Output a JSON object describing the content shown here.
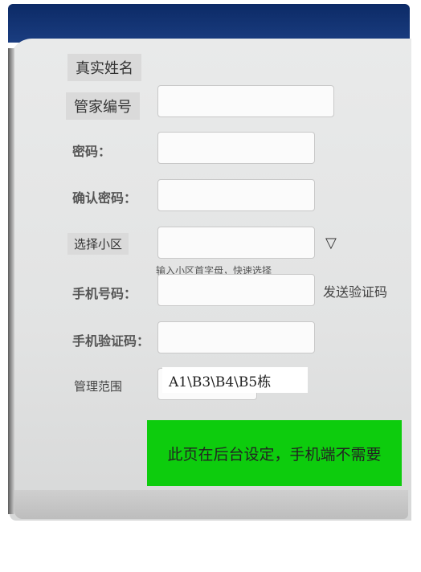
{
  "form": {
    "real_name_label": "真实姓名",
    "butler_id_label": "管家编号",
    "password_label": "密码：",
    "confirm_password_label": "确认密码：",
    "community_label": "选择小区",
    "community_hint": "输入小区首字母，快速选择",
    "phone_label": "手机号码：",
    "send_code_label": "发送验证码",
    "code_label": "手机验证码：",
    "range_label": "管理范围",
    "range_value": "A1\\B3\\B4\\B5栋"
  },
  "note": {
    "text": "此页在后台设定，手机端不需要",
    "bg_color": "#0dcc0d"
  },
  "icons": {
    "dropdown": "triangle-down-icon"
  }
}
